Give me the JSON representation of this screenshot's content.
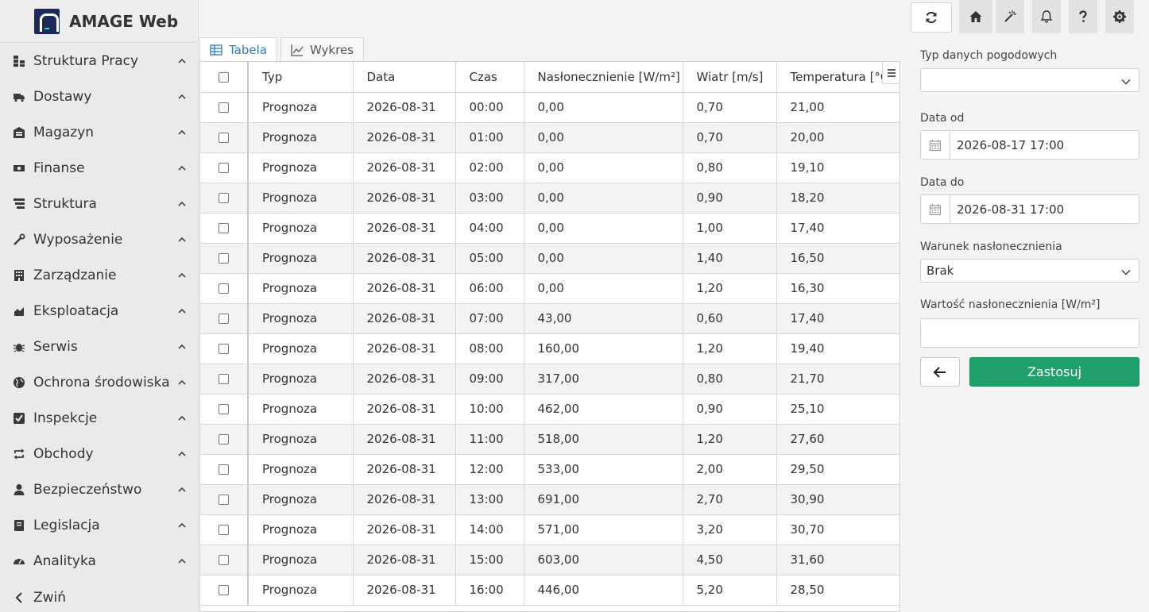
{
  "app": {
    "title": "AMAGE Web"
  },
  "sidebar": {
    "items": [
      {
        "label": "Struktura Pracy",
        "icon": "sitemap-icon"
      },
      {
        "label": "Dostawy",
        "icon": "truck-icon"
      },
      {
        "label": "Magazyn",
        "icon": "warehouse-icon"
      },
      {
        "label": "Finanse",
        "icon": "money-icon"
      },
      {
        "label": "Struktura",
        "icon": "tree-icon"
      },
      {
        "label": "Wyposażenie",
        "icon": "wrench-icon"
      },
      {
        "label": "Zarządzanie",
        "icon": "building-icon"
      },
      {
        "label": "Eksploatacja",
        "icon": "operation-icon"
      },
      {
        "label": "Serwis",
        "icon": "bug-icon"
      },
      {
        "label": "Ochrona środowiska",
        "icon": "globe-icon"
      },
      {
        "label": "Inspekcje",
        "icon": "check-square-icon"
      },
      {
        "label": "Obchody",
        "icon": "exchange-icon"
      },
      {
        "label": "Bezpieczeństwo",
        "icon": "user-icon"
      },
      {
        "label": "Legislacja",
        "icon": "book-icon"
      },
      {
        "label": "Analityka",
        "icon": "dashboard-icon"
      }
    ],
    "collapse_label": "Zwiń"
  },
  "tabs": [
    {
      "label": "Tabela",
      "icon": "table-icon",
      "active": true
    },
    {
      "label": "Wykres",
      "icon": "line-chart-icon",
      "active": false
    }
  ],
  "table": {
    "columns": [
      "Typ",
      "Data",
      "Czas",
      "Nasłonecznienie [W/m²]",
      "Wiatr [m/s]",
      "Temperatura [°C]"
    ],
    "rows": [
      [
        "Prognoza",
        "2026-08-31",
        "00:00",
        "0,00",
        "0,70",
        "21,00"
      ],
      [
        "Prognoza",
        "2026-08-31",
        "01:00",
        "0,00",
        "0,70",
        "20,00"
      ],
      [
        "Prognoza",
        "2026-08-31",
        "02:00",
        "0,00",
        "0,80",
        "19,10"
      ],
      [
        "Prognoza",
        "2026-08-31",
        "03:00",
        "0,00",
        "0,90",
        "18,20"
      ],
      [
        "Prognoza",
        "2026-08-31",
        "04:00",
        "0,00",
        "1,00",
        "17,40"
      ],
      [
        "Prognoza",
        "2026-08-31",
        "05:00",
        "0,00",
        "1,40",
        "16,50"
      ],
      [
        "Prognoza",
        "2026-08-31",
        "06:00",
        "0,00",
        "1,20",
        "16,30"
      ],
      [
        "Prognoza",
        "2026-08-31",
        "07:00",
        "43,00",
        "0,60",
        "17,40"
      ],
      [
        "Prognoza",
        "2026-08-31",
        "08:00",
        "160,00",
        "1,20",
        "19,40"
      ],
      [
        "Prognoza",
        "2026-08-31",
        "09:00",
        "317,00",
        "0,80",
        "21,70"
      ],
      [
        "Prognoza",
        "2026-08-31",
        "10:00",
        "462,00",
        "0,90",
        "25,10"
      ],
      [
        "Prognoza",
        "2026-08-31",
        "11:00",
        "518,00",
        "1,20",
        "27,60"
      ],
      [
        "Prognoza",
        "2026-08-31",
        "12:00",
        "533,00",
        "2,00",
        "29,50"
      ],
      [
        "Prognoza",
        "2026-08-31",
        "13:00",
        "691,00",
        "2,70",
        "30,90"
      ],
      [
        "Prognoza",
        "2026-08-31",
        "14:00",
        "571,00",
        "3,20",
        "30,70"
      ],
      [
        "Prognoza",
        "2026-08-31",
        "15:00",
        "603,00",
        "4,50",
        "31,60"
      ],
      [
        "Prognoza",
        "2026-08-31",
        "16:00",
        "446,00",
        "5,20",
        "28,50"
      ]
    ]
  },
  "toolbar": {
    "buttons": [
      "refresh-icon",
      "home-icon",
      "magic-icon",
      "bell-icon",
      "help-icon",
      "gear-icon"
    ]
  },
  "filters": {
    "weather_type_label": "Typ danych pogodowych",
    "weather_type_value": "",
    "date_from_label": "Data od",
    "date_from_value": "2026-08-17 17:00",
    "date_to_label": "Data do",
    "date_to_value": "2026-08-31 17:00",
    "insolation_condition_label": "Warunek nasłonecznienia",
    "insolation_condition_value": "Brak",
    "insolation_value_label": "Wartość nasłonecznienia [W/m²]",
    "insolation_value": "",
    "apply_label": "Zastosuj"
  },
  "colors": {
    "accent": "#2d7ac6",
    "apply": "#20a06a",
    "brand": "#1c2b5a"
  }
}
